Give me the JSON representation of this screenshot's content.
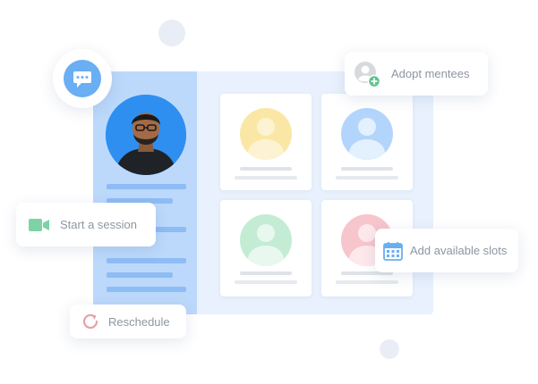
{
  "chips": {
    "adopt_mentees": "Adopt mentees",
    "start_session": "Start a session",
    "add_slots": "Add available slots",
    "reschedule": "Reschedule"
  },
  "icons": {
    "chat": "chat-bubble-icon",
    "adopt": "user-plus-icon",
    "video": "video-camera-icon",
    "calendar": "calendar-icon",
    "reschedule": "refresh-icon"
  },
  "colors": {
    "sidebar": "#bcd9fb",
    "panel": "#e8f1fd",
    "accent_blue": "#6aaef3",
    "mentee_yellow": "#fbe7a5",
    "mentee_blue": "#b3d5fb",
    "mentee_green": "#c4ecd5",
    "mentee_pink": "#f7c5cc",
    "video_green": "#7dd3a5",
    "plus_green": "#5ec48e",
    "reschedule_red": "#e7a0a6"
  }
}
